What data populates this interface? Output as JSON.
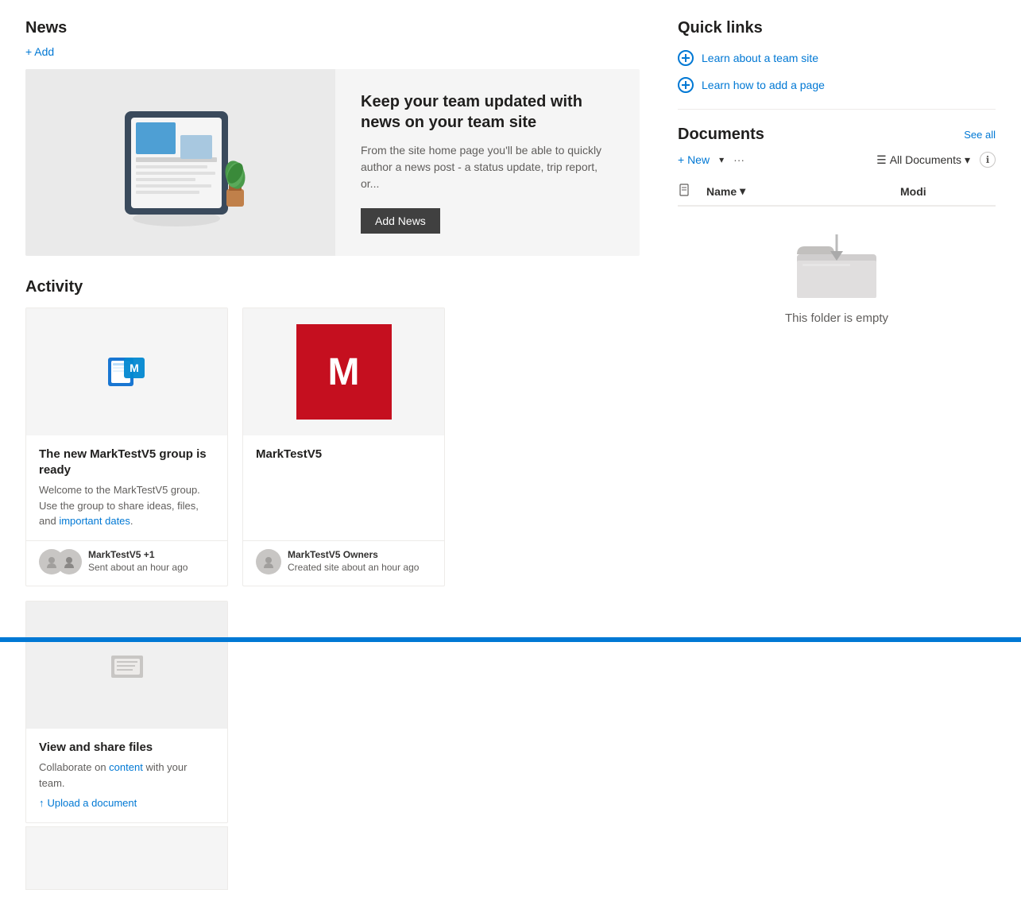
{
  "news": {
    "title": "News",
    "add_label": "+ Add",
    "headline": "Keep your team updated with news on your team site",
    "body": "From the site home page you'll be able to quickly author a news post - a status update, trip report, or...",
    "add_news_button": "Add News"
  },
  "activity": {
    "title": "Activity",
    "cards": [
      {
        "id": "outlook-card",
        "type": "outlook",
        "title": "The new MarkTestV5 group is ready",
        "desc_parts": [
          {
            "text": "Welcome to the MarkTestV5 group. Use the group to share ideas, files, and "
          },
          {
            "text": "important dates",
            "link": true
          },
          {
            "text": "."
          }
        ],
        "footer_name": "MarkTestV5 +1",
        "footer_sub": "Sent about an hour ago"
      },
      {
        "id": "group-card",
        "type": "avatar",
        "avatar_letter": "M",
        "title": "MarkTestV5",
        "footer_name": "MarkTestV5 Owners",
        "footer_sub": "Created site about an hour ago"
      },
      {
        "id": "files-card",
        "type": "files",
        "title": "View and share files",
        "desc": "Collaborate on content with your team.",
        "upload_label": "Upload a document"
      }
    ]
  },
  "quick_links": {
    "title": "Quick links",
    "links": [
      {
        "label": "Learn about a team site"
      },
      {
        "label": "Learn how to add a page"
      }
    ]
  },
  "documents": {
    "title": "Documents",
    "see_all": "See all",
    "new_label": "+ New",
    "more_label": "···",
    "view_label": "All Documents",
    "col_name": "Name",
    "col_modified": "Modi",
    "empty_text": "This folder is empty"
  }
}
